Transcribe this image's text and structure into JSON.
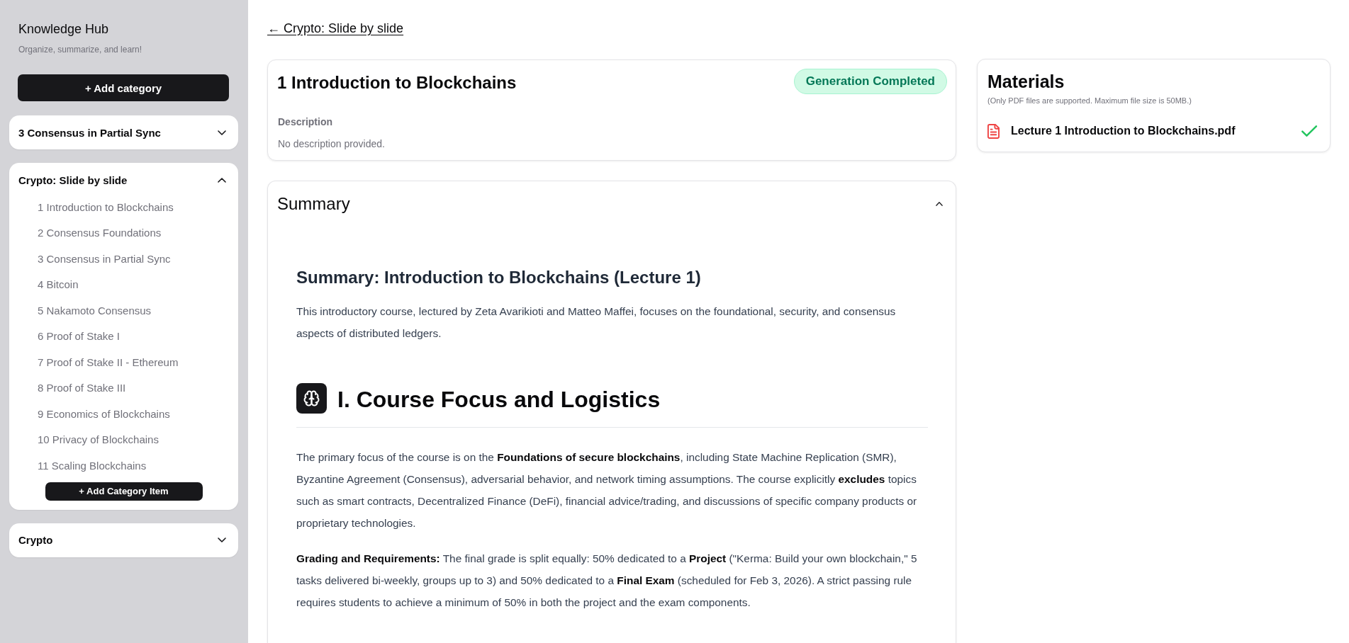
{
  "sidebar": {
    "title": "Knowledge Hub",
    "subtitle": "Organize, summarize, and learn!",
    "add_category_button": "+ Add category",
    "categories": [
      {
        "name": "3 Consensus in Partial Sync",
        "expanded": false
      },
      {
        "name": "Crypto: Slide by slide",
        "expanded": true,
        "items": [
          "1 Introduction to Blockchains",
          "2 Consensus Foundations",
          "3 Consensus in Partial Sync",
          "4 Bitcoin",
          "5 Nakamoto Consensus",
          "6 Proof of Stake I",
          "7 Proof of Stake II - Ethereum",
          "8 Proof of Stake III",
          "9 Economics of Blockchains",
          "10 Privacy of Blockchains",
          "11 Scaling Blockchains"
        ],
        "add_item_button": "+ Add Category Item"
      },
      {
        "name": "Crypto",
        "expanded": false
      }
    ]
  },
  "back_link": "← Crypto: Slide by slide",
  "lecture": {
    "title": "1 Introduction to Blockchains",
    "status": {
      "label": "Generation Completed",
      "kind": "completed"
    },
    "description_label": "Description",
    "description": "No description provided."
  },
  "materials": {
    "title": "Materials",
    "note": "(Only PDF files are supported. Maximum file size is 50MB.)",
    "files": [
      {
        "name": "Lecture 1 Introduction to Blockchains.pdf",
        "uploaded": true
      }
    ]
  },
  "summary": {
    "title": "Summary",
    "expanded": true,
    "content": [
      {
        "kind": "heading",
        "text": "Summary: Introduction to Blockchains (Lecture 1)"
      },
      {
        "kind": "paragraph",
        "text": "This introductory course, lectured by Zeta Avarikioti and Matteo Maffei, focuses on the foundational, security, and consensus aspects of distributed ledgers."
      },
      {
        "kind": "section",
        "text": "I. Course Focus and Logistics"
      },
      {
        "kind": "paragraph",
        "text": "The primary focus of the course is on the **Foundations of secure blockchains**, including State Machine Replication (SMR), Byzantine Agreement (Consensus), adversarial behavior, and network timing assumptions. The course explicitly **excludes** topics such as smart contracts, Decentralized Finance (DeFi), financial advice/trading, and discussions of specific company products or proprietary technologies."
      },
      {
        "kind": "paragraph",
        "text": "**Grading and Requirements:** The final grade is split equally: 50% dedicated to a **Project** (\"Kerma: Build your own blockchain,\" 5 tasks delivered bi-weekly, groups up to 3) and 50% dedicated to a **Final Exam** (scheduled for Feb 3, 2026). A strict passing rule requires students to achieve a minimum of 50% in both the project and the exam components."
      }
    ]
  }
}
